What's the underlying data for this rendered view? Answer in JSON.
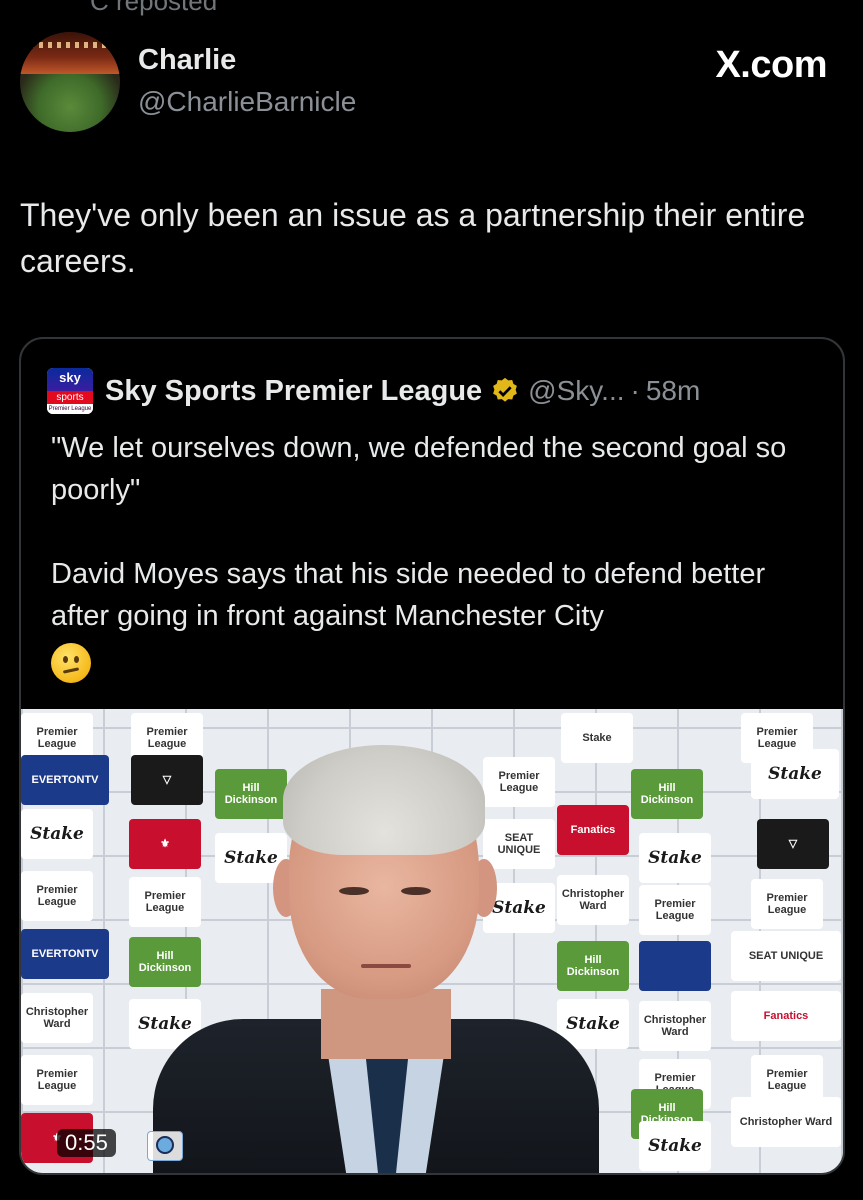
{
  "top": {
    "repost_text": "C reposted"
  },
  "post": {
    "author_name": "Charlie",
    "author_handle": "@CharlieBarnicle",
    "brand": "X.com",
    "text": "They've only been an issue as a partnership their entire careers."
  },
  "quote": {
    "logo": {
      "line1": "sky",
      "line2": "sports",
      "line3": "Premier League"
    },
    "author_name": "Sky Sports Premier League",
    "author_handle": "@Sky...",
    "separator": "·",
    "time": "58m",
    "paragraph1": "\"We let ourselves down, we defended the second goal so poorly\"",
    "paragraph2": "David Moyes says that his side needed to defend better after going in front against Manchester City",
    "emoji": "confused-face"
  },
  "media": {
    "duration": "0:55",
    "board": {
      "premier_league": "Premier League",
      "stake": "Stake",
      "hill_dickinson": "Hill Dickinson",
      "evertontv": "EVERTONTV",
      "seat_unique": "SEAT UNIQUE",
      "fanatics": "Fanatics",
      "christopher_ward": "Christopher Ward"
    }
  }
}
